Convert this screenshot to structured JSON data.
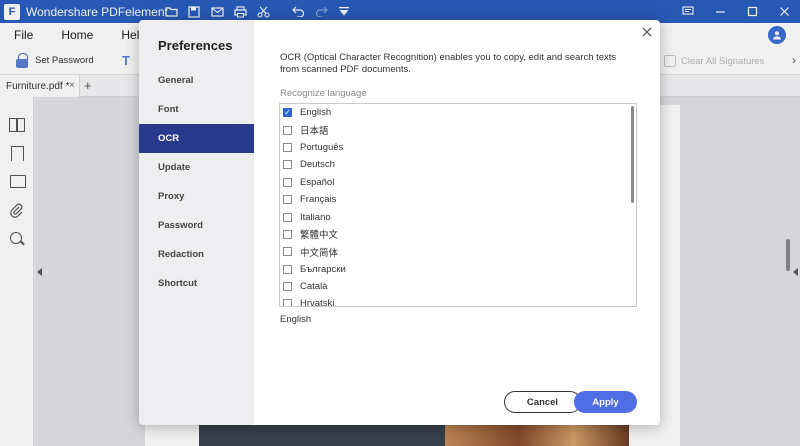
{
  "titlebar": {
    "app_title": "Wondershare PDFelement",
    "logo_letter": "F",
    "icons": [
      "folder-icon",
      "save-icon",
      "mail-icon",
      "print-icon",
      "cut-icon",
      "undo-icon",
      "redo-icon",
      "dropdown-icon"
    ],
    "window_controls": [
      "message-icon",
      "minimize-icon",
      "maximize-icon",
      "close-icon"
    ]
  },
  "menubar": {
    "items": [
      "File",
      "Home",
      "Help"
    ]
  },
  "toolbar": {
    "set_password": "Set Password",
    "clear_signatures": "Clear All Signatures"
  },
  "tabs": {
    "doc_tab": "Furniture.pdf *",
    "close": "×",
    "add": "+"
  },
  "dialog": {
    "title": "Preferences",
    "nav": [
      "General",
      "Font",
      "OCR",
      "Update",
      "Proxy",
      "Password",
      "Redaction",
      "Shortcut"
    ],
    "active_nav": "OCR",
    "description": "OCR (Optical Character Recognition) enables you to copy, edit and search texts from scanned PDF documents.",
    "recognize_label": "Recognize language",
    "languages": [
      {
        "name": "English",
        "checked": true
      },
      {
        "name": "日本語",
        "checked": false
      },
      {
        "name": "Português",
        "checked": false
      },
      {
        "name": "Deutsch",
        "checked": false
      },
      {
        "name": "Español",
        "checked": false
      },
      {
        "name": "Français",
        "checked": false
      },
      {
        "name": "Italiano",
        "checked": false
      },
      {
        "name": "繁體中文",
        "checked": false
      },
      {
        "name": "中文简体",
        "checked": false
      },
      {
        "name": "Български",
        "checked": false
      },
      {
        "name": "Català",
        "checked": false
      },
      {
        "name": "Hrvatski",
        "checked": false
      }
    ],
    "selected_languages": "English",
    "cancel": "Cancel",
    "apply": "Apply"
  },
  "colors": {
    "titlebar": "#2a5ebf",
    "nav_active": "#273a8c",
    "apply": "#4f6ee6",
    "checkbox": "#2c64d6"
  }
}
